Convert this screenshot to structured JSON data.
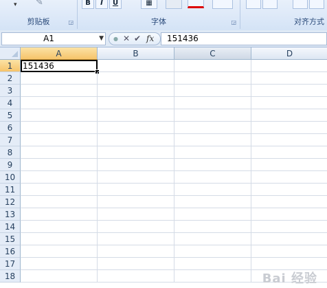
{
  "ribbon": {
    "groups": [
      {
        "label": "剪贴板"
      },
      {
        "label": "字体"
      },
      {
        "label": "对齐方式"
      }
    ],
    "font_buttons": [
      "B",
      "I",
      "U"
    ]
  },
  "formula_bar": {
    "name_box": "A1",
    "fx_symbol": "fx",
    "formula_value": "151436"
  },
  "sheet": {
    "columns": [
      "A",
      "B",
      "C",
      "D"
    ],
    "rows": [
      "1",
      "2",
      "3",
      "4",
      "5",
      "6",
      "7",
      "8",
      "9",
      "10",
      "11",
      "12",
      "13",
      "14",
      "15",
      "16",
      "17",
      "18"
    ],
    "cells": {
      "A1": "151436"
    },
    "active_cell": "A1"
  },
  "watermark": "Bai 经验"
}
